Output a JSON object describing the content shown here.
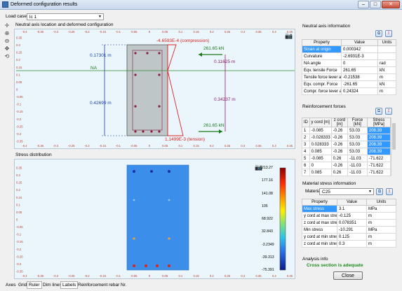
{
  "window": {
    "title": "Deformed configuration results",
    "minimize": "–",
    "maximize": "□",
    "close": "✕"
  },
  "load_case": {
    "label": "Load case",
    "value": "lc 1"
  },
  "toolbar_icons": [
    "crosshair-icon",
    "zoom-in-icon",
    "zoom-out-icon",
    "pan-icon",
    "reset-icon"
  ],
  "plot1": {
    "title": "Neutral axis location and deformed configuration",
    "axis_top_ticks": [
      "-0.4",
      "-0.35",
      "-0.3",
      "-0.25",
      "-0.2",
      "-0.15",
      "-0.1",
      "-0.05",
      "0",
      "0.05",
      "0.1",
      "0.15",
      "0.2",
      "0.25",
      "0.3",
      "0.35",
      "0.4",
      "0.45"
    ],
    "axis_left_ticks": [
      "0.35",
      "0.3",
      "0.25",
      "0.2",
      "0.15",
      "0.1",
      "0.05",
      "0",
      "-0.05",
      "-0.1",
      "-0.15",
      "-0.2",
      "-0.25",
      "-0.3",
      "-0.35"
    ],
    "na_label": "NA",
    "dim_top": "0.17301 m",
    "dim_bottom": "0.42699 m",
    "compression_label": "-4.6593E-4 (compression)",
    "tension_label": "1.1499E-3 (tension)",
    "force_top": "261.65 kN",
    "force_bottom": "261.65 kN",
    "arm_top": "0.11625 m",
    "arm_bottom": "0.34237 m",
    "camera_icon": "camera-icon"
  },
  "plot2": {
    "title": "Stress distribution",
    "axis_left_ticks": [
      "0.35",
      "0.3",
      "0.25",
      "0.2",
      "0.15",
      "0.1",
      "0.05",
      "0",
      "-0.05",
      "-0.1",
      "-0.15",
      "-0.2",
      "-0.25",
      "-0.3",
      "-0.35"
    ],
    "axis_bottom_ticks": [
      "-0.4",
      "-0.35",
      "-0.3",
      "-0.25",
      "-0.2",
      "-0.15",
      "-0.1",
      "-0.05",
      "0",
      "0.05",
      "0.1",
      "0.15",
      "0.2",
      "0.25",
      "0.3",
      "0.35",
      "0.4",
      "0.45"
    ],
    "colorbar_ticks": [
      "213.27",
      "177.16",
      "141.08",
      "105",
      "68.922",
      "32.843",
      "-3.2349",
      "-39.313",
      "-75.391"
    ],
    "camera_icon": "camera-icon"
  },
  "neutral_axis_info": {
    "title": "Neutral axis information",
    "columns": [
      "Property",
      "Value",
      "Units"
    ],
    "rows": [
      [
        "Strain at origin",
        "0.000342",
        ""
      ],
      [
        "Curvature",
        "-2.6931E-3",
        ""
      ],
      [
        "NA angle",
        "0",
        "rad"
      ],
      [
        "Eqv. tensile Force",
        "261.65",
        "kN"
      ],
      [
        "Tensile force lever arm",
        "-0.21538",
        "m"
      ],
      [
        "Eqv. compr. Force",
        "-261.65",
        "kN"
      ],
      [
        "Compr. force lever arm",
        "0.24324",
        "m"
      ]
    ]
  },
  "reinforcement_forces": {
    "title": "Reinforcement forces",
    "columns": [
      "ID",
      "y cord [m]",
      "z cord [m]",
      "Force [kN]",
      "Stress [MPa]"
    ],
    "rows": [
      [
        "1",
        "-0.085",
        "-0.26",
        "53.03",
        "208.39"
      ],
      [
        "2",
        "-0.028333",
        "-0.26",
        "53.03",
        "208.39"
      ],
      [
        "3",
        "0.028333",
        "-0.26",
        "53.03",
        "208.39"
      ],
      [
        "4",
        "0.085",
        "-0.26",
        "53.03",
        "208.39"
      ],
      [
        "5",
        "-0.085",
        "0.26",
        "-11.03",
        "-71.622"
      ],
      [
        "6",
        "0",
        "-0.26",
        "-11.03",
        "-71.622"
      ],
      [
        "7",
        "0.085",
        "0.26",
        "-11.03",
        "-71.622"
      ]
    ]
  },
  "material_stress": {
    "title": "Material stress information",
    "material_label": "Material",
    "material_value": "C25",
    "columns": [
      "Property",
      "Value",
      "Units"
    ],
    "rows": [
      [
        "Max stress",
        "3.1",
        "MPa"
      ],
      [
        "y cord at max stress",
        "-0.125",
        "m"
      ],
      [
        "z cord at max stress",
        "0.078351",
        "m"
      ],
      [
        "Min stress",
        "-10.291",
        "MPa"
      ],
      [
        "y cord at min stress",
        "0.125",
        "m"
      ],
      [
        "z cord at min stress",
        "0.3",
        "m"
      ]
    ]
  },
  "analysis_info": {
    "title": "Analysis info",
    "message": "Cross section is adequate"
  },
  "close_button": "Close",
  "bottom_tabs": [
    "Axes",
    "Grid",
    "Ruler",
    "Dim lines",
    "Labels",
    "Reinforcement rebar Nr."
  ],
  "colors": {
    "accent": "#3399ff",
    "ok": "#1d8a1d",
    "section_fill": "#bfc6c8",
    "stress_fill": "#3b8fea"
  }
}
